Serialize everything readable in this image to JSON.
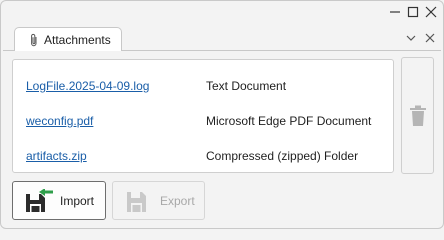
{
  "tab": {
    "label": "Attachments",
    "icon": "paperclip-icon"
  },
  "attachments": [
    {
      "name": "LogFile.2025-04-09.log",
      "type": "Text Document"
    },
    {
      "name": "weconfig.pdf",
      "type": "Microsoft Edge PDF Document"
    },
    {
      "name": "artifacts.zip",
      "type": "Compressed (zipped) Folder"
    }
  ],
  "buttons": {
    "import_label": "Import",
    "export_label": "Export",
    "delete_icon": "trash-icon"
  },
  "colors": {
    "link": "#1a5ea8",
    "import_arrow": "#2e9e4a",
    "disabled": "#a8a8a8"
  }
}
